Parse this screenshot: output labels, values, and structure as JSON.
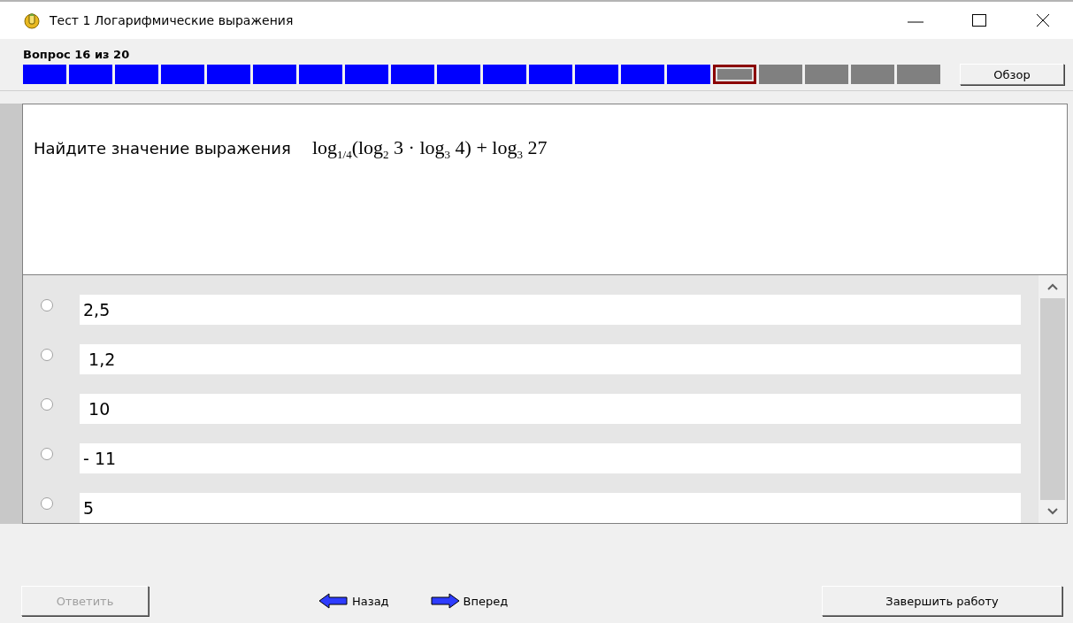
{
  "window": {
    "title": "Тест 1 Логарифмические выражения"
  },
  "progress": {
    "label": "Вопрос 16 из 20",
    "review_button": "Обзор",
    "cells": [
      {
        "kind": "answered",
        "selected": false
      },
      {
        "kind": "answered",
        "selected": false
      },
      {
        "kind": "answered",
        "selected": false
      },
      {
        "kind": "answered",
        "selected": false
      },
      {
        "kind": "answered",
        "selected": false
      },
      {
        "kind": "answered",
        "selected": false
      },
      {
        "kind": "answered",
        "selected": false
      },
      {
        "kind": "answered",
        "selected": false
      },
      {
        "kind": "answered",
        "selected": false
      },
      {
        "kind": "answered",
        "selected": false
      },
      {
        "kind": "answered",
        "selected": false
      },
      {
        "kind": "answered",
        "selected": false
      },
      {
        "kind": "answered",
        "selected": false
      },
      {
        "kind": "answered",
        "selected": false
      },
      {
        "kind": "answered",
        "selected": false
      },
      {
        "kind": "unanswered",
        "selected": true
      },
      {
        "kind": "unanswered",
        "selected": false
      },
      {
        "kind": "unanswered",
        "selected": false
      },
      {
        "kind": "unanswered",
        "selected": false
      },
      {
        "kind": "unanswered",
        "selected": false
      }
    ]
  },
  "question": {
    "text": "Найдите  значение выражения",
    "formula": "log$_{1/4}$(log$_{2}$ 3 · log$_{3}$ 4) + log$_{3}$ 27"
  },
  "options": [
    {
      "text": "2,5",
      "selected": false
    },
    {
      "text": " 1,2",
      "selected": false
    },
    {
      "text": " 10",
      "selected": false
    },
    {
      "text": "- 11",
      "selected": false
    },
    {
      "text": "5",
      "selected": false
    }
  ],
  "footer": {
    "answer_button": {
      "label": "Ответить",
      "disabled": true
    },
    "back": "Назад",
    "forward": "Вперед",
    "finish_button": "Завершить работу"
  }
}
